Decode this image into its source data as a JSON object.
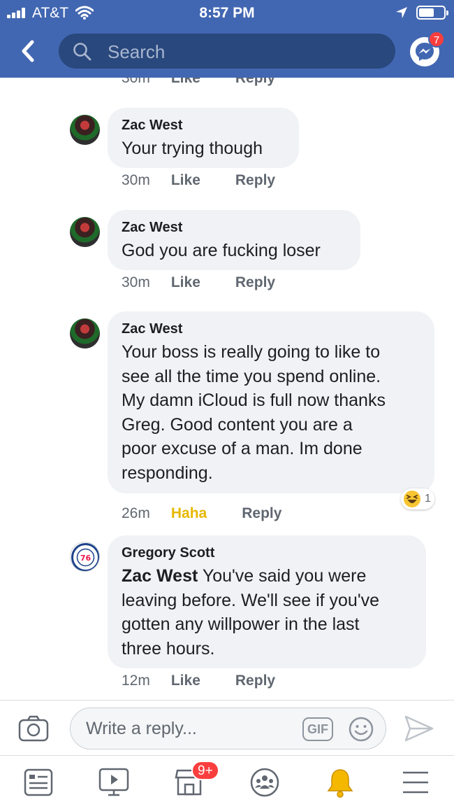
{
  "status_bar": {
    "carrier": "AT&T",
    "time": "8:57 PM"
  },
  "nav": {
    "search_placeholder": "Search",
    "messenger_badge": "7"
  },
  "partial_top": {
    "time": "30m",
    "like_label": "Like",
    "reply_label": "Reply"
  },
  "comments": [
    {
      "author": "Zac West",
      "text": "Your trying though",
      "time": "30m",
      "like_label": "Like",
      "reply_label": "Reply"
    },
    {
      "author": "Zac West",
      "text": "God you are fucking loser",
      "time": "30m",
      "like_label": "Like",
      "reply_label": "Reply"
    },
    {
      "author": "Zac West",
      "text_lines": [
        "Your boss is really going to like to",
        "see all the time you spend online.",
        "My damn iCloud is full now thanks",
        "Greg. Good content you are a",
        "poor excuse of a man. Im done",
        "responding."
      ],
      "time": "26m",
      "like_label": "Haha",
      "reply_label": "Reply",
      "reaction": {
        "icon": "laughing-emoji-icon",
        "count": "1"
      }
    },
    {
      "author": "Gregory Scott",
      "tag": "Zac West",
      "text_lines": [
        "You've said you were",
        "leaving before. We'll see if you've",
        "gotten any willpower in the last",
        "three hours."
      ],
      "time": "12m",
      "like_label": "Like",
      "reply_label": "Reply"
    }
  ],
  "composer": {
    "placeholder": "Write a reply...",
    "gif_label": "GIF"
  },
  "tabbar": {
    "icons": [
      "news-feed-icon",
      "watch-icon",
      "marketplace-icon",
      "groups-icon",
      "notifications-icon",
      "menu-icon"
    ],
    "marketplace_badge": "9+"
  },
  "colors": {
    "brand": "#4267b2",
    "search_bg": "#29487d",
    "bubble": "#f0f2f5",
    "badge": "#fa3e3e",
    "haha": "#e7b800",
    "bell": "#f5b800"
  }
}
